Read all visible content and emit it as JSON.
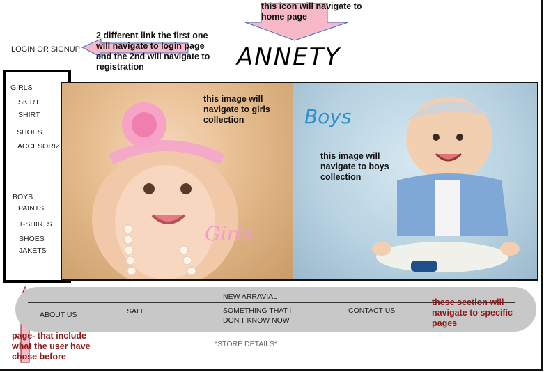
{
  "header": {
    "login_label": "LOGIN OR SIGNUP",
    "logo_text": "ANNETY"
  },
  "annotations": {
    "logo_note": "this icon will navigate to home page",
    "login_note": "2 different link the first one will navigate to login page and the 2nd will navigate to registration",
    "girls_note": "this image will navigate to girls collection",
    "boys_note": "this image will navigate to boys collection",
    "footer_note": "these section will navigate to specific pages",
    "sidebar_note": "page- that include what the user have chose before"
  },
  "sidebar": {
    "girls_heading": "GIRLS",
    "girls_items": [
      "SKIRT",
      "SHIRT",
      "SHOES",
      "ACCESORIZE"
    ],
    "boys_heading": "BOYS",
    "boys_items": [
      "PAINTS",
      "T-SHIRTS",
      "SHOES",
      "JAKETS"
    ]
  },
  "hero": {
    "girls_label": "Girls",
    "boys_label": "Boys"
  },
  "footer": {
    "new_arrival": "NEW ARRAVIAL",
    "about": "ABOUT US",
    "sale": "SALE",
    "something": "SOMETHING THAT i DON'T KNOW NOW",
    "contact": "CONTACT US",
    "store_details": "*STORE DETAILS*"
  },
  "colors": {
    "arrow_fill": "#f7b8c8",
    "girls_text": "#f39ad0",
    "boys_text": "#2c8fd0",
    "footer_bg": "#c8c8c8"
  }
}
